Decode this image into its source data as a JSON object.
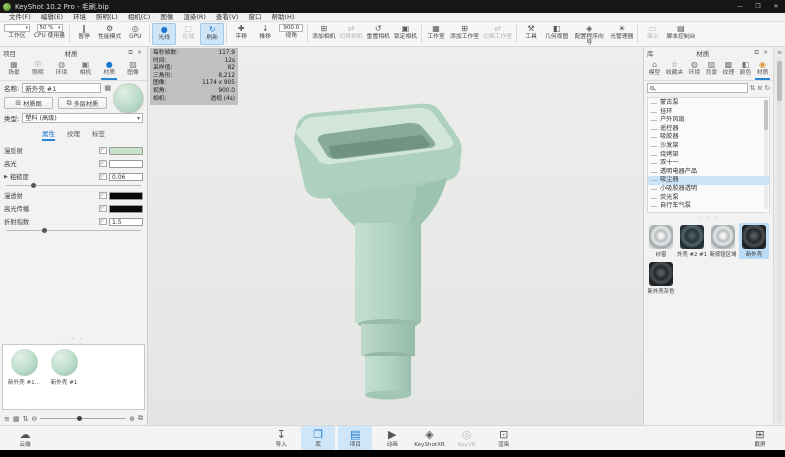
{
  "window": {
    "title": "KeyShot 10.2 Pro  -  毛刷.bip",
    "controls": {
      "minimize": "—",
      "maximize": "❐",
      "close": "✕"
    }
  },
  "menubar": {
    "items": [
      {
        "label": "文件(F)"
      },
      {
        "label": "编辑(E)"
      },
      {
        "label": "环境"
      },
      {
        "label": "照明(L)"
      },
      {
        "label": "相机(C)"
      },
      {
        "label": "图像"
      },
      {
        "label": "渲染(R)"
      },
      {
        "label": "查看(V)"
      },
      {
        "label": "窗口"
      },
      {
        "label": "帮助(H)"
      }
    ]
  },
  "toolbar": {
    "items": [
      {
        "label": "工作区",
        "combo": " "
      },
      {
        "label": "CPU 使用量",
        "combo": "50 %"
      },
      {
        "type": "sep"
      },
      {
        "label": "暂停",
        "glyph": "‖"
      },
      {
        "label": "性能模式",
        "glyph": "⚙"
      },
      {
        "label": "GPU",
        "glyph": "◎"
      },
      {
        "type": "sep"
      },
      {
        "label": "光线",
        "glyph": "●",
        "state": "active"
      },
      {
        "label": "区域",
        "glyph": "▢",
        "state": "disabled"
      },
      {
        "label": "刷新",
        "glyph": "↻",
        "state": "active"
      },
      {
        "type": "sep"
      },
      {
        "label": "平移",
        "glyph": "✚"
      },
      {
        "label": "推移",
        "glyph": "↓"
      },
      {
        "label": "视角",
        "field": "900.0"
      },
      {
        "type": "sep"
      },
      {
        "label": "添加相机",
        "glyph": "⊞"
      },
      {
        "label": "切换相机",
        "glyph": "⇄",
        "state": "disabled"
      },
      {
        "label": "重置相机",
        "glyph": "↺"
      },
      {
        "label": "锁定相机",
        "glyph": "▣"
      },
      {
        "type": "sep"
      },
      {
        "label": "工作室",
        "glyph": "▦"
      },
      {
        "label": "添加工作室",
        "glyph": "⊞"
      },
      {
        "label": "切换工作室",
        "glyph": "⇄",
        "state": "disabled"
      },
      {
        "type": "sep"
      },
      {
        "label": "工具",
        "glyph": "⚒"
      },
      {
        "label": "几何视图",
        "glyph": "◧"
      },
      {
        "label": "配置程序向导",
        "glyph": "◈"
      },
      {
        "label": "光管理器",
        "glyph": "☀"
      },
      {
        "type": "sep"
      },
      {
        "label": "演示",
        "glyph": "▭",
        "state": "disabled"
      },
      {
        "label": "脚本控制台",
        "glyph": "▤"
      }
    ]
  },
  "project_panel": {
    "header": {
      "left": "项目",
      "title": "材质",
      "float_icon": "⧉",
      "close_icon": "✕"
    },
    "tabs": [
      {
        "label": "场景",
        "glyph": "▦"
      },
      {
        "label": "照明",
        "glyph": "☉"
      },
      {
        "label": "环境",
        "glyph": "◍"
      },
      {
        "label": "相机",
        "glyph": "▣"
      },
      {
        "label": "材质",
        "glyph": "●",
        "state": "active"
      },
      {
        "label": "图像",
        "glyph": "▨"
      }
    ],
    "name_label": "名称:",
    "name_value": "新外壳 #1",
    "save_icon": "▦",
    "buttons": [
      {
        "label": "材质图",
        "glyph": "⊞"
      },
      {
        "label": "多层材质",
        "glyph": "⧉"
      }
    ],
    "type_label": "类型:",
    "type_value": "塑料 (高级)",
    "subtabs": [
      {
        "label": "属性",
        "state": "active"
      },
      {
        "label": "纹理"
      },
      {
        "label": "标签"
      }
    ],
    "properties": [
      {
        "label": "漫反射",
        "swatch": "#c5e2c8"
      },
      {
        "label": "高光",
        "swatch": "#ffffff"
      },
      {
        "label": "粗糙度",
        "arrow": "▶",
        "value": "0.06",
        "slider_pos": "20%"
      },
      {
        "label": "漫透射",
        "swatch": "#0a0a0a"
      },
      {
        "label": "高光传播",
        "swatch": "#0a0a0a"
      },
      {
        "label": "折射指数",
        "value": "1.5",
        "slider_pos": "28%"
      }
    ],
    "splitter_dots": "· · ·",
    "tray": {
      "items": [
        {
          "label": "新外壳 #1..."
        },
        {
          "label": "新外壳 #1"
        }
      ]
    }
  },
  "viewport": {
    "stats": [
      {
        "k": "每秒帧数:",
        "v": "117.9"
      },
      {
        "k": "时间:",
        "v": "12s"
      },
      {
        "k": "采样值:",
        "v": "82"
      },
      {
        "k": "三角形:",
        "v": "8,212"
      },
      {
        "k": "图像:",
        "v": "1174 x 905"
      },
      {
        "k": "视角:",
        "v": "900.0"
      },
      {
        "k": "相机:",
        "v": "透视 (4s)"
      }
    ]
  },
  "library_panel": {
    "header": {
      "left": "库",
      "title": "材质",
      "float_icon": "⧉",
      "close_icon": "✕"
    },
    "tabs": [
      {
        "label": "模型",
        "glyph": "⌂"
      },
      {
        "label": "收藏夹",
        "glyph": "☆"
      },
      {
        "label": "环境",
        "glyph": "◍"
      },
      {
        "label": "背景",
        "glyph": "▨"
      },
      {
        "label": "纹理",
        "glyph": "▩"
      },
      {
        "label": "颜色",
        "glyph": "◧"
      },
      {
        "label": "材质",
        "glyph": "◉",
        "state": "active"
      }
    ],
    "search": {
      "placeholder": ""
    },
    "folders": [
      {
        "label": "蒙古泵"
      },
      {
        "label": "挂环"
      },
      {
        "label": "户外风扇"
      },
      {
        "label": "遥控器"
      },
      {
        "label": "吸胶器"
      },
      {
        "label": "沙发架"
      },
      {
        "label": "烧烤架"
      },
      {
        "label": "双十一"
      },
      {
        "label": "透明电器产品"
      },
      {
        "label": "吸尘器",
        "state": "selected"
      },
      {
        "label": "小吸胶器透明"
      },
      {
        "label": "荧光泵"
      },
      {
        "label": "自行车气泵"
      }
    ],
    "splitter_dots": "· · ·",
    "thumbnails": [
      {
        "label": "纱窗",
        "style": "t-silver"
      },
      {
        "label": "外壳 #2 #1...",
        "style": "t-teal"
      },
      {
        "label": "新按钮区域",
        "style": "t-silver"
      },
      {
        "label": "新外壳",
        "style": "t-dark",
        "state": "selected"
      },
      {
        "label": "新外壳灰色",
        "style": "t-dark"
      }
    ]
  },
  "bottombar": {
    "left": {
      "label": "云端",
      "glyph": "☁"
    },
    "items": [
      {
        "label": "导入",
        "glyph": "↧"
      },
      {
        "label": "库",
        "glyph": "❐",
        "state": "active"
      },
      {
        "label": "项目",
        "glyph": "▤",
        "state": "active"
      },
      {
        "label": "动画",
        "glyph": "▶"
      },
      {
        "label": "KeyShotXR",
        "glyph": "◈"
      },
      {
        "label": "KeyVR",
        "glyph": "◎",
        "state": "disabled"
      },
      {
        "label": "渲染",
        "glyph": "⊡"
      }
    ],
    "right": {
      "label": "截屏",
      "glyph": "⊞"
    }
  }
}
